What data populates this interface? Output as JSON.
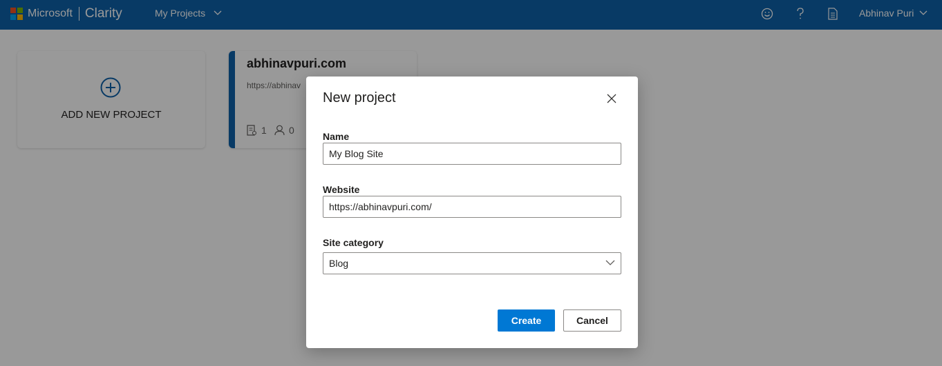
{
  "header": {
    "brand_company": "Microsoft",
    "brand_product": "Clarity",
    "nav_label": "My Projects",
    "user_name": "Abhinav Puri",
    "logo_colors": [
      "#f25022",
      "#7fba00",
      "#00a4ef",
      "#ffb900"
    ],
    "icons": [
      "smiley-icon",
      "help-icon",
      "document-icon",
      "chevron-down-icon"
    ]
  },
  "cards": {
    "add_label": "ADD NEW PROJECT",
    "project": {
      "title": "abhinavpuri.com",
      "url": "https://abhinav",
      "recordings": "1",
      "users": "0"
    }
  },
  "dialog": {
    "title": "New project",
    "name_label": "Name",
    "name_value": "My Blog Site",
    "website_label": "Website",
    "website_value": "https://abhinavpuri.com/",
    "category_label": "Site category",
    "category_value": "Blog",
    "create_label": "Create",
    "cancel_label": "Cancel"
  },
  "colors": {
    "header_bg": "#0e61a9",
    "primary": "#0078d4",
    "accent": "#0e61a9"
  }
}
